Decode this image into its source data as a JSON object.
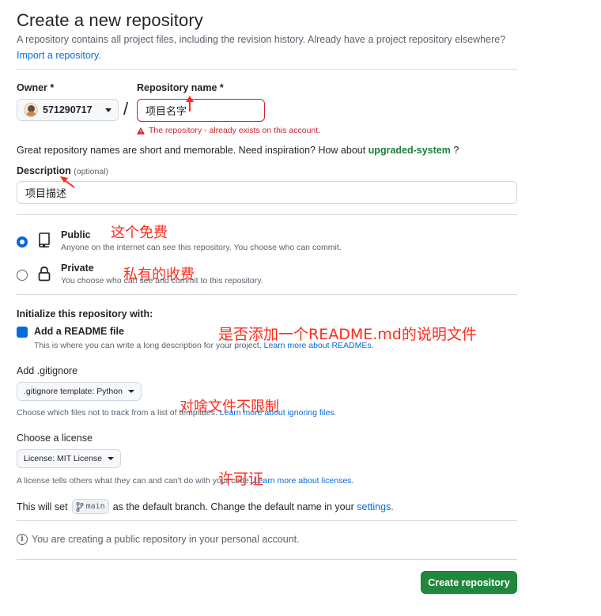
{
  "colors": {
    "accent": "#0969da",
    "primary_button": "#1f883d",
    "error": "#d1242f",
    "success_text": "#1a7f37",
    "annotation": "#ff2a1a"
  },
  "header": {
    "title": "Create a new repository",
    "subtitle": "A repository contains all project files, including the revision history. Already have a project repository elsewhere?",
    "import_link": "Import a repository."
  },
  "owner": {
    "label": "Owner *",
    "value": "571290717",
    "icon": "avatar"
  },
  "separator": "/",
  "repository_name": {
    "label": "Repository name *",
    "value": "项目名字",
    "error": "The repository - already exists on this account.",
    "error_icon": "alert-triangle-icon"
  },
  "inspiration": {
    "text": "Great repository names are short and memorable. Need inspiration? How about ",
    "suggestion": "upgraded-system",
    "suffix": " ?"
  },
  "description": {
    "label": "Description",
    "optional": "(optional)",
    "value": "项目描述"
  },
  "visibility": {
    "options": [
      {
        "title": "Public",
        "description": "Anyone on the internet can see this repository. You choose who can commit.",
        "icon": "repo-icon",
        "checked": true
      },
      {
        "title": "Private",
        "description": "You choose who can see and commit to this repository.",
        "icon": "lock-icon",
        "checked": false
      }
    ]
  },
  "initialize": {
    "title": "Initialize this repository with:",
    "readme": {
      "label": "Add a README file",
      "checked": true,
      "help": "This is where you can write a long description for your project. ",
      "help_link": "Learn more about READMEs."
    }
  },
  "gitignore": {
    "title": "Add .gitignore",
    "select_label": ".gitignore template: Python",
    "help": "Choose which files not to track from a list of templates. ",
    "help_link": "Learn more about ignoring files."
  },
  "license": {
    "title": "Choose a license",
    "select_label": "License: MIT License",
    "help": "A license tells others what they can and can't do with your code. ",
    "help_link": "Learn more about licenses."
  },
  "branch": {
    "before": "This will set",
    "branch_name": "main",
    "after": "as the default branch. Change the default name in your",
    "settings_link": "settings."
  },
  "notice": {
    "text": "You are creating a public repository in your personal account.",
    "icon": "info-icon"
  },
  "submit": {
    "label": "Create repository"
  },
  "annotations": {
    "public_note": "这个免费",
    "private_note": "私有的收费",
    "readme_note": "是否添加一个README.md的说明文件",
    "gitignore_note": "对啥文件不限制",
    "license_note": "许可证"
  }
}
